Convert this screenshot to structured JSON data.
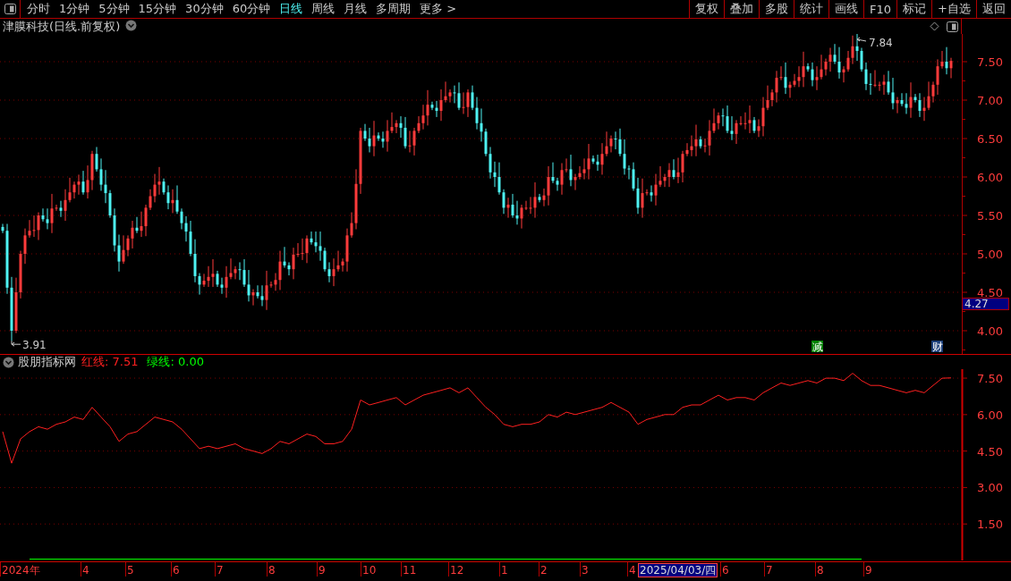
{
  "toolbar": {
    "tabs": [
      {
        "label": "分时",
        "selected": false
      },
      {
        "label": "1分钟",
        "selected": false
      },
      {
        "label": "5分钟",
        "selected": false
      },
      {
        "label": "15分钟",
        "selected": false
      },
      {
        "label": "30分钟",
        "selected": false
      },
      {
        "label": "60分钟",
        "selected": false
      },
      {
        "label": "日线",
        "selected": true
      },
      {
        "label": "周线",
        "selected": false
      },
      {
        "label": "月线",
        "selected": false
      },
      {
        "label": "多周期",
        "selected": false
      },
      {
        "label": "更多 >",
        "selected": false
      }
    ],
    "buttons": [
      "复权",
      "叠加",
      "多股",
      "统计",
      "画线",
      "F10",
      "标记",
      "+自选",
      "返回"
    ]
  },
  "price_chart": {
    "title": "津膜科技(日线.前复权)",
    "y_labels": [
      "7.50",
      "7.00",
      "6.50",
      "6.00",
      "5.50",
      "5.00",
      "4.50",
      "4.00"
    ],
    "high_label": "7.84",
    "low_label": "3.91",
    "cursor_price": "4.27",
    "events": [
      {
        "label": "减",
        "color": "#008000"
      },
      {
        "label": "财",
        "color": "#1c3f7a"
      }
    ]
  },
  "indicator": {
    "name": "股朋指标网",
    "legend": [
      ": 7.51",
      ": 0.00"
    ],
    "chart_data": {
      "type": "line",
      "grid": true,
      "ylim": [
        0,
        7.87
      ],
      "yticks": [
        {
          "value": 7.5,
          "label": "7.50"
        },
        {
          "value": 6,
          "label": "6.00"
        },
        {
          "value": 4.5,
          "label": "4.50"
        },
        {
          "value": 3,
          "label": "3.00"
        },
        {
          "value": 1.5,
          "label": "1.50"
        }
      ],
      "series": [
        {
          "name": "红线",
          "color": "#ff2020",
          "values": [
            5.3,
            4.0,
            5.0,
            5.3,
            5.5,
            5.4,
            5.6,
            5.7,
            5.9,
            5.8,
            6.3,
            5.9,
            5.5,
            4.9,
            5.2,
            5.3,
            5.6,
            5.9,
            5.8,
            5.7,
            5.4,
            5.0,
            4.6,
            4.7,
            4.6,
            4.7,
            4.8,
            4.6,
            4.5,
            4.4,
            4.6,
            4.9,
            4.8,
            5.0,
            5.2,
            5.1,
            4.8,
            4.8,
            4.9,
            5.4,
            6.6,
            6.4,
            6.5,
            6.6,
            6.7,
            6.4,
            6.6,
            6.8,
            6.9,
            7.0,
            7.1,
            6.9,
            7.1,
            6.7,
            6.3,
            6.0,
            5.6,
            5.5,
            5.6,
            5.6,
            5.7,
            6.0,
            5.9,
            6.1,
            6.0,
            6.1,
            6.2,
            6.3,
            6.5,
            6.3,
            6.1,
            5.6,
            5.8,
            5.9,
            6.0,
            6.0,
            6.3,
            6.4,
            6.4,
            6.6,
            6.8,
            6.6,
            6.7,
            6.7,
            6.6,
            6.9,
            7.1,
            7.3,
            7.2,
            7.3,
            7.4,
            7.3,
            7.5,
            7.5,
            7.4,
            7.7,
            7.4,
            7.2,
            7.2,
            7.1,
            7.0,
            6.9,
            7.0,
            6.9,
            7.2,
            7.5,
            7.51
          ]
        },
        {
          "name": "绿线",
          "color": "#00ff00",
          "values": [
            null,
            null,
            null,
            0,
            0,
            0,
            0,
            0,
            0,
            0,
            0,
            0,
            0,
            0,
            0,
            0,
            0,
            0,
            0,
            0,
            0,
            0,
            0,
            0,
            0,
            0,
            0,
            0,
            0,
            0,
            0,
            0,
            0,
            0,
            0,
            0,
            0,
            0,
            0,
            0,
            0,
            0,
            0,
            0,
            0,
            0,
            0,
            0,
            0,
            0,
            0,
            0,
            0,
            0,
            0,
            0,
            0,
            0,
            0,
            0,
            0,
            0,
            0,
            0,
            0,
            0,
            0,
            0,
            0,
            0,
            0,
            0,
            0,
            0,
            0,
            0,
            0,
            0,
            0,
            0,
            0,
            0,
            0,
            0,
            0,
            0,
            0,
            0,
            0,
            0,
            0,
            0,
            0,
            0,
            0,
            0,
            0,
            null,
            null,
            null,
            null,
            null,
            null,
            null,
            null,
            null,
            null
          ]
        }
      ]
    }
  },
  "date_axis": {
    "labels": [
      "2024年",
      "4",
      "5",
      "6",
      "7",
      "8",
      "9",
      "10",
      "11",
      "12",
      "1",
      "2",
      "3",
      "4",
      "6",
      "7",
      "8",
      "9"
    ],
    "cursor_date": "2025/04/03/四"
  }
}
